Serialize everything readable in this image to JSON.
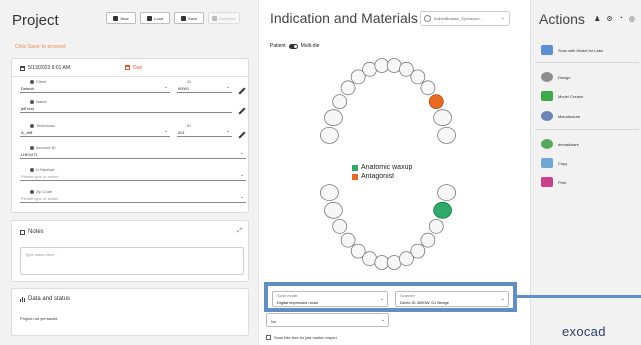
{
  "project": {
    "title": "Project",
    "toolbar": {
      "new": "New",
      "load": "Load",
      "save": "Save",
      "duplicate": "Duplicate"
    },
    "save_hint": "Click 'Save' to proceed",
    "datetime": "5/13/2023 9:01 AM",
    "due_label": "Due",
    "fields": {
      "client_label": "Client",
      "client_value": "Default",
      "client_id_label": "ID",
      "client_id_value": "00001",
      "name_label": "Name",
      "name_value": "jeff test",
      "technician_label": "Technician",
      "technician_value": "A_Jeff",
      "technician_id_label": "ID",
      "technician_id_value": "001",
      "account_label": "Account ID",
      "account_value": "LHE1071",
      "dentist_label": "D.Hauthat",
      "dentist_placeholder": "Please type or select",
      "zip_label": "Zip Code",
      "zip_placeholder": "Please type or select"
    },
    "notes_title": "Notes",
    "notes_placeholder": "Type notes here...",
    "status_title": "Data and status",
    "status_value": "Project not yet saved"
  },
  "center": {
    "title": "Indication and Materials",
    "material_dropdown": "IndividBrowse_Operacion...",
    "view_left": "Patient",
    "view_right": "Multi-die",
    "legend": [
      {
        "label": "Anatomic waxup",
        "color": "#2eab6a"
      },
      {
        "label": "Antagonist",
        "color": "#e86a22"
      }
    ],
    "scan_mode_label": "Scan mode",
    "scan_mode_value": "Digital impression scan",
    "scanner_label": "Scanner",
    "scanner_value": "Dentx ID 3000W, DJ Bridge",
    "sub_value": "No",
    "edit_check_label": "Scan bite fork for jaw motion import"
  },
  "actions": {
    "title": "Actions",
    "items": [
      {
        "label": "Scan with Model for Labs",
        "color": "#5b8fd6"
      },
      {
        "label": "Design",
        "color": "#8d8d8d"
      },
      {
        "label": "Model Creator",
        "color": "#3daa4b"
      },
      {
        "label": "Manufacture",
        "color": "#6b84b5"
      },
      {
        "label": "dentalshare",
        "color": "#58a85b"
      },
      {
        "label": "Copy",
        "color": "#6fa7d6"
      },
      {
        "label": "Print",
        "color": "#c8418a"
      }
    ],
    "brand": "exocad"
  }
}
